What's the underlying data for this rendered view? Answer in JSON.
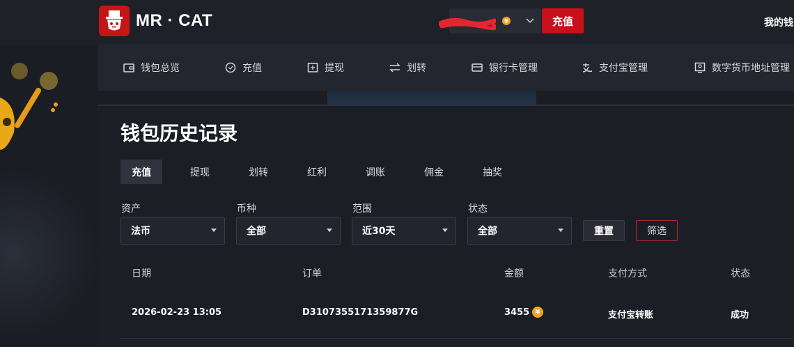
{
  "header": {
    "logo_text": "MR · CAT",
    "account_currency_symbol": "¥",
    "recharge_button": "充值",
    "my_wallet_link": "我的钱"
  },
  "nav": {
    "items": [
      {
        "label": "钱包总览",
        "icon": "wallet-icon"
      },
      {
        "label": "充值",
        "icon": "recharge-icon"
      },
      {
        "label": "提现",
        "icon": "withdraw-icon"
      },
      {
        "label": "划转",
        "icon": "transfer-icon"
      },
      {
        "label": "银行卡管理",
        "icon": "bank-card-icon"
      },
      {
        "label": "支付宝管理",
        "icon": "alipay-icon"
      },
      {
        "label": "数字货币地址管理",
        "icon": "crypto-address-icon"
      }
    ]
  },
  "page": {
    "title": "钱包历史记录",
    "tabs": [
      "充值",
      "提现",
      "划转",
      "红利",
      "调账",
      "佣金",
      "抽奖"
    ],
    "active_tab": "充值"
  },
  "filters": {
    "asset": {
      "label": "资产",
      "value": "法币"
    },
    "currency": {
      "label": "币种",
      "value": "全部"
    },
    "range": {
      "label": "范围",
      "value": "近30天"
    },
    "status": {
      "label": "状态",
      "value": "全部"
    },
    "reset_button": "重置",
    "filter_button": "筛选"
  },
  "table": {
    "headers": [
      "日期",
      "订单",
      "金额",
      "支付方式",
      "状态"
    ],
    "rows": [
      {
        "date": "2026-02-23 13:05",
        "order": "D3107355171359877G",
        "amount": "3455",
        "currency_symbol": "¥",
        "payment_method": "支付宝转账",
        "status": "成功"
      }
    ]
  },
  "colors": {
    "accent_red": "#c8101a",
    "coin_gold": "#f3a520",
    "background": "#1b1d24"
  }
}
